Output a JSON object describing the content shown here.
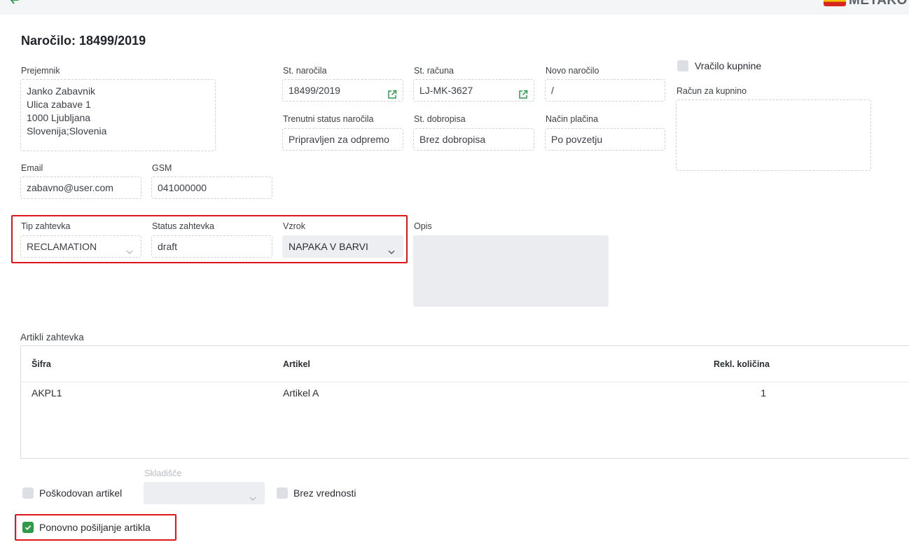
{
  "header": {
    "logo_text": "METAKO"
  },
  "page_title": "Naročilo: 18499/2019",
  "recipient": {
    "label": "Prejemnik",
    "lines": [
      "Janko Zabavnik",
      "Ulica zabave 1",
      "1000 Ljubljana",
      "Slovenija;Slovenia"
    ]
  },
  "email": {
    "label": "Email",
    "value": "zabavno@user.com"
  },
  "gsm": {
    "label": "GSM",
    "value": "041000000"
  },
  "order_number": {
    "label": "St. naročila",
    "value": "18499/2019"
  },
  "invoice_number": {
    "label": "St. računa",
    "value": "LJ-MK-3627"
  },
  "new_order": {
    "label": "Novo naročilo",
    "value": "/"
  },
  "order_status": {
    "label": "Trenutni status naročila",
    "value": "Pripravljen za odpremo"
  },
  "credit_note": {
    "label": "St. dobropisa",
    "value": "Brez dobropisa"
  },
  "payment_method": {
    "label": "Način plačina",
    "value": "Po povzetju"
  },
  "refund": {
    "label": "Vračilo kupnine",
    "checked": false
  },
  "refund_invoice": {
    "label": "Račun za kupnino",
    "value": ""
  },
  "request_type": {
    "label": "Tip zahtevka",
    "value": "RECLAMATION"
  },
  "request_status": {
    "label": "Status zahtevka",
    "value": "draft"
  },
  "cause": {
    "label": "Vzrok",
    "value": "NAPAKA V BARVI"
  },
  "description": {
    "label": "Opis",
    "value": ""
  },
  "items": {
    "section_label": "Artikli zahtevka",
    "columns": [
      "Šifra",
      "Artikel",
      "Rekl. količina"
    ],
    "rows": [
      [
        "AKPL1",
        "Artikel A",
        "1"
      ]
    ]
  },
  "options": {
    "damaged": {
      "label": "Poškodovan artikel",
      "checked": false
    },
    "warehouse": {
      "label": "Skladišče",
      "value": ""
    },
    "no_value": {
      "label": "Brez vrednosti",
      "checked": false
    },
    "resend": {
      "label": "Ponovno pošiljanje artikla",
      "checked": true
    }
  },
  "colors": {
    "accent_green": "#2f9a48",
    "highlight_red": "#e0161b"
  },
  "icons": {
    "back": "back-arrow-icon",
    "external_link": "external-link-icon",
    "chevron": "chevron-down-icon",
    "check": "checkmark-icon"
  }
}
